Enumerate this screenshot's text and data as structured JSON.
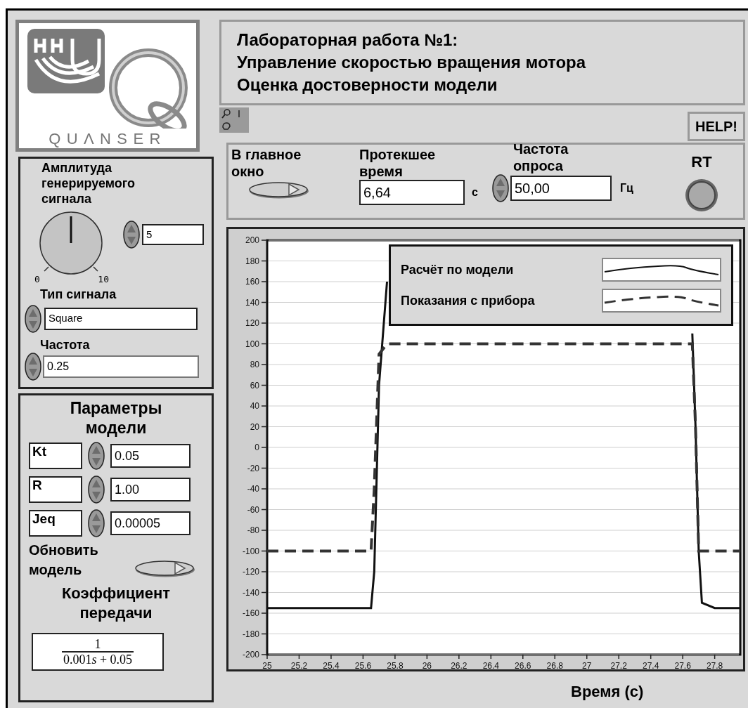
{
  "logo": {
    "text": "QUΛNSER"
  },
  "title_lines": [
    "Лабораторная работа №1:",
    "Управление скоростью вращения мотора",
    "Оценка достоверности модели"
  ],
  "help_button": "HELP!",
  "controls": {
    "main_window": {
      "label": "В главное окно"
    },
    "elapsed": {
      "label": "Протекшее время",
      "value": "6,64",
      "unit": "с"
    },
    "rate": {
      "label": "Частота опроса",
      "value": "50,00",
      "unit": "Гц"
    },
    "rt": {
      "label": "RT",
      "on": false
    }
  },
  "signal": {
    "title": "Амплитуда генерируемого сигнала",
    "knob": {
      "min": "0",
      "max": "10"
    },
    "amplitude_value": "5",
    "type_label": "Тип сигнала",
    "type_value": "Square",
    "freq_label": "Частота",
    "freq_value": "0.25"
  },
  "model": {
    "title": "Параметры модели",
    "params": [
      {
        "name": "Kt",
        "value": "0.05"
      },
      {
        "name": "R",
        "value": "1.00"
      },
      {
        "name": "Jeq",
        "value": "0.00005"
      }
    ],
    "update_label": "Обновить модель",
    "gain_title": "Коэффициент передачи",
    "gain": {
      "numerator": "1",
      "denominator_coefficient": "0.001",
      "denominator_variable": "s",
      "denominator_rest": "+ 0.05"
    }
  },
  "chart": {
    "xlabel": "Время (с)",
    "chart_data": {
      "type": "line",
      "grid": true,
      "x": [
        25,
        25.2,
        25.4,
        25.6,
        25.65,
        25.67,
        25.7,
        25.75,
        25.8,
        26.5,
        27.2,
        27.6,
        27.66,
        27.68,
        27.7,
        27.72,
        27.8,
        27.96
      ],
      "series": [
        {
          "name": "Расчёт по модели",
          "color": "#111111",
          "line_style": "solid",
          "values": [
            -155,
            -155,
            -155,
            -155,
            -155,
            -120,
            60,
            160,
            null,
            null,
            null,
            null,
            110,
            20,
            -100,
            -150,
            -155,
            -155
          ]
        },
        {
          "name": "Показания с прибора",
          "color": "#333333",
          "line_style": "dashed",
          "values": [
            -100,
            -100,
            -100,
            -100,
            -100,
            -40,
            90,
            100,
            100,
            100,
            100,
            100,
            100,
            20,
            -100,
            -100,
            -100,
            -100
          ]
        }
      ],
      "xlim": [
        25,
        27.96
      ],
      "ylim": [
        -200,
        200
      ],
      "xticks": [
        25,
        25.2,
        25.4,
        25.6,
        25.8,
        26,
        26.2,
        26.4,
        26.6,
        26.8,
        27,
        27.2,
        27.4,
        27.6,
        27.8
      ],
      "yticks": [
        -200,
        -180,
        -160,
        -140,
        -120,
        -100,
        -80,
        -60,
        -40,
        -20,
        0,
        20,
        40,
        60,
        80,
        100,
        120,
        140,
        160,
        180,
        200
      ]
    }
  }
}
